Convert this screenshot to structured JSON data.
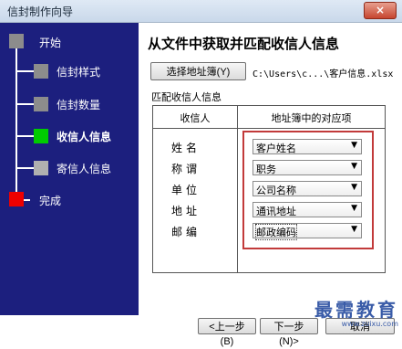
{
  "window": {
    "title": "信封制作向导",
    "close_label": "×"
  },
  "steps": [
    {
      "label": "开始",
      "color": "#8c8c8c",
      "active": false
    },
    {
      "label": "信封样式",
      "color": "#8c8c8c",
      "active": false
    },
    {
      "label": "信封数量",
      "color": "#8c8c8c",
      "active": false
    },
    {
      "label": "收信人信息",
      "color": "#00cc00",
      "active": true
    },
    {
      "label": "寄信人信息",
      "color": "#b0b0b0",
      "active": false
    },
    {
      "label": "完成",
      "color": "#ee0000",
      "active": false
    }
  ],
  "main": {
    "heading": "从文件中获取并匹配收信人信息",
    "browse_button": "选择地址簿(Y)",
    "file_path": "C:\\Users\\c...\\客户信息.xlsx",
    "section_label": "匹配收信人信息",
    "col_recipient": "收信人",
    "col_mapping": "地址簿中的对应项",
    "rows": [
      {
        "label": "姓名",
        "value": "客户姓名"
      },
      {
        "label": "称谓",
        "value": "职务"
      },
      {
        "label": "单位",
        "value": "公司名称"
      },
      {
        "label": "地址",
        "value": "通讯地址"
      },
      {
        "label": "邮编",
        "value": "邮政编码"
      }
    ]
  },
  "footer": {
    "prev": "<上一步(B)",
    "next": "下一步(N)>",
    "cancel": "取消"
  },
  "watermark": {
    "text": "最需教育",
    "url": "www.zuixu.com"
  },
  "colors": {
    "sidebar": "#1c1f7e",
    "highlight": "#c23a3a"
  }
}
